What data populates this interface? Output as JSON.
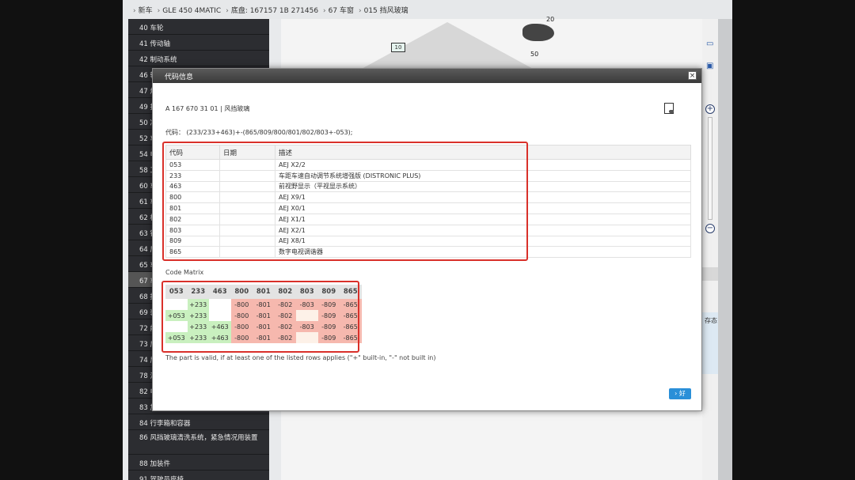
{
  "breadcrumb": [
    "新车",
    "GLE 450 4MATIC",
    "底盘: 167157 1B 271456",
    "67 车窗",
    "015 挡风玻璃"
  ],
  "sidebar": {
    "items": [
      "40 车轮",
      "41 传动轴",
      "42 制动系统",
      "46 转",
      "47 燃",
      "49 排",
      "50 冷",
      "52 车",
      "54 电",
      "58 工",
      "60 车",
      "61 车",
      "62 框",
      "63 镜",
      "64 后",
      "65 车",
      "67 车",
      "68 撑",
      "69 装",
      "72 前",
      "73 后",
      "74 后",
      "78 滑",
      "82 电",
      "83 加",
      "84 行李箱和容器",
      "86 风挡玻璃清洗系统，紧急情况用装置",
      "88 加装件",
      "91 驾驶员座椅"
    ],
    "active_index": 16
  },
  "diagram": {
    "box_label": "10",
    "label_50": "50",
    "label_20": "20"
  },
  "modal": {
    "title": "代码信息",
    "close_label": "×",
    "part": "A 167 670 31 01 | 风挡玻璃",
    "code_expression": "代码： (233/233+463)+-(865/809/800/801/802/803+-053);",
    "table": {
      "headers": [
        "代码",
        "日期",
        "描述"
      ],
      "rows": [
        [
          "053",
          "",
          "AEJ X2/2"
        ],
        [
          "233",
          "",
          "车距车速自动调节系统增强版 (DISTRONIC PLUS)"
        ],
        [
          "463",
          "",
          "前视野显示（平视显示系统）"
        ],
        [
          "800",
          "",
          "AEJ X9/1"
        ],
        [
          "801",
          "",
          "AEJ X0/1"
        ],
        [
          "802",
          "",
          "AEJ X1/1"
        ],
        [
          "803",
          "",
          "AEJ X2/1"
        ],
        [
          "809",
          "",
          "AEJ X8/1"
        ],
        [
          "865",
          "",
          "数字电视调谐器"
        ]
      ]
    },
    "matrix_label": "Code Matrix",
    "matrix": {
      "headers": [
        "053",
        "233",
        "463",
        "800",
        "801",
        "802",
        "803",
        "809",
        "865"
      ],
      "rows": [
        [
          "",
          "+233",
          "",
          "-800",
          "-801",
          "-802",
          "-803",
          "-809",
          "-865"
        ],
        [
          "+053",
          "+233",
          "",
          "-800",
          "-801",
          "-802",
          "",
          "-809",
          "-865"
        ],
        [
          "",
          "+233",
          "+463",
          "-800",
          "-801",
          "-802",
          "-803",
          "-809",
          "-865"
        ],
        [
          "+053",
          "+233",
          "+463",
          "-800",
          "-801",
          "-802",
          "",
          "-809",
          "-865"
        ]
      ]
    },
    "valid_note": "The part is valid, if at least one of the listed rows applies (\"+\" built-in, \"-\" not built in)",
    "ok_label": "› 好"
  },
  "right_panel": {
    "text": "存态"
  },
  "colors": {
    "plus": "#c9f0bf",
    "minus": "#f6b8ae",
    "highlight": "#d9302a",
    "ok": "#2a8fd8"
  }
}
